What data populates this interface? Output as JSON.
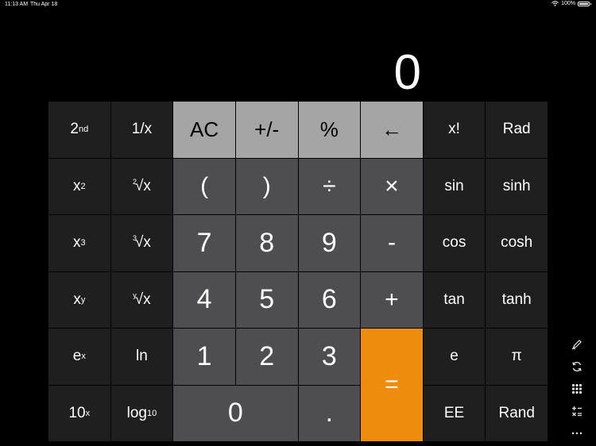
{
  "status_bar": {
    "time": "11:13 AM",
    "date": "Thu Apr 18",
    "wifi_icon": "wifi-icon",
    "battery_percent": "100%",
    "battery_level": 1.0
  },
  "display": {
    "value": "0"
  },
  "keys": [
    [
      "2nd",
      "1/x",
      "AC",
      "+/-",
      "%",
      "←",
      "x!",
      "Rad"
    ],
    [
      "x²",
      "²√x",
      "(",
      ")",
      "÷",
      "×",
      "sin",
      "sinh"
    ],
    [
      "x³",
      "³√x",
      "7",
      "8",
      "9",
      "-",
      "cos",
      "cosh"
    ],
    [
      "xʸ",
      "ʸ√x",
      "4",
      "5",
      "6",
      "+",
      "tan",
      "tanh"
    ],
    [
      "eˣ",
      "ln",
      "1",
      "2",
      "3",
      "=",
      "e",
      "π"
    ],
    [
      "10ˣ",
      "log₁₀",
      "0",
      ".",
      "EE",
      "Rand"
    ]
  ],
  "labels": {
    "second": "2nd",
    "inverse": "1/x",
    "ac": "AC",
    "sign": "+/-",
    "percent": "%",
    "backspace": "←",
    "factorial": "x!",
    "rad": "Rad",
    "x_squared": "x",
    "sq_root_x": "x",
    "lparen": "(",
    "rparen": ")",
    "divide": "÷",
    "multiply": "×",
    "sin": "sin",
    "sinh": "sinh",
    "x_cubed": "x",
    "cube_root_x": "x",
    "seven": "7",
    "eight": "8",
    "nine": "9",
    "minus": "-",
    "cos": "cos",
    "cosh": "cosh",
    "x_pow_y": "x",
    "y_root_x": "x",
    "four": "4",
    "five": "5",
    "six": "6",
    "plus": "+",
    "tan": "tan",
    "tanh": "tanh",
    "e_pow_x": "e",
    "ln": "ln",
    "one": "1",
    "two": "2",
    "three": "3",
    "equals": "=",
    "e": "e",
    "pi": "π",
    "ten_pow_x": "10",
    "log10": "log",
    "zero": "0",
    "decimal": ".",
    "ee": "EE",
    "rand": "Rand"
  },
  "superscripts": {
    "nd": "nd",
    "two": "2",
    "three": "3",
    "y": "y",
    "x": "x",
    "sub10": "10"
  },
  "sidebar_icons": [
    "pen-icon",
    "refresh-icon",
    "grid-icon",
    "operators-icon",
    "more-icon"
  ],
  "colors": {
    "background": "#000000",
    "scientific_key": "#1f1f1f",
    "number_key": "#4e4e50",
    "function_key": "#a5a5a5",
    "equals_key": "#ee8d0d"
  }
}
